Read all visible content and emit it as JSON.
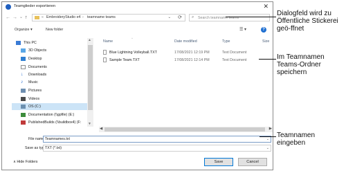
{
  "window": {
    "title": "Teamglieder exportieren",
    "close_glyph": "✕"
  },
  "address": {
    "back_glyph": "←",
    "forward_glyph": "→",
    "recent_glyph": "⌄",
    "up_glyph": "↑",
    "segments": [
      "EmbroideryStudio e4",
      "teamname teams"
    ],
    "chevron": "›",
    "lead_chevron": "«",
    "dropdown_glyph": "⌄",
    "refresh_glyph": "⟳",
    "search_placeholder": "Search teamname teams"
  },
  "toolbar": {
    "organize": "Organize ▾",
    "new_folder": "New folder",
    "view_glyph": "☰ ▾",
    "help": "?"
  },
  "nav": {
    "items": [
      {
        "label": "This PC",
        "icon": "pc-icon",
        "color": "#3a7bd5"
      },
      {
        "label": "3D Objects",
        "icon": "folder-3d-icon",
        "color": "#5aa7e6"
      },
      {
        "label": "Desktop",
        "icon": "desktop-icon",
        "color": "#2f7fd2"
      },
      {
        "label": "Documents",
        "icon": "documents-icon",
        "color": "#8f8f8f"
      },
      {
        "label": "Downloads",
        "icon": "downloads-icon",
        "color": "#2a6fd0"
      },
      {
        "label": "Music",
        "icon": "music-icon",
        "color": "#2a6fd0"
      },
      {
        "label": "Pictures",
        "icon": "pictures-icon",
        "color": "#6f8fb0"
      },
      {
        "label": "Videos",
        "icon": "videos-icon",
        "color": "#4a4a4a"
      },
      {
        "label": "OS (C:)",
        "icon": "drive-icon",
        "color": "#6b8fb0"
      },
      {
        "label": "Documentation (\\\\gpfile) (E:)",
        "icon": "network-drive-icon",
        "color": "#3c8c3c"
      },
      {
        "label": "PublishedBuilds (\\\\buildbox4) (F:",
        "icon": "network-drive-icon",
        "color": "#c03a3a"
      }
    ]
  },
  "files": {
    "columns": [
      "Name",
      "Date modified",
      "Type",
      "Size"
    ],
    "sort_caret": "^",
    "rows": [
      {
        "name": "Blue Lightning Volleyball.TXT",
        "date": "17/08/2021 12:19 PM",
        "type": "Text Document"
      },
      {
        "name": "Sample Team.TXT",
        "date": "17/08/2021 12:14 PM",
        "type": "Text Document"
      }
    ]
  },
  "form": {
    "filename_label": "File name:",
    "filename_value": "Teamnames.txt",
    "type_label": "Save as type:",
    "type_value": "TXT (*.txt)",
    "combo_glyph": "⌄"
  },
  "footer": {
    "hide_folders": "∧  Hide Folders",
    "save": "Save",
    "cancel": "Cancel"
  },
  "callouts": {
    "dialog_opened": [
      "Dialogfeld wird zu",
      "Öffentliche Stickerei",
      "geö-ffnet"
    ],
    "teams_folder": [
      "Im Teamnamen",
      "Teams-Ordner",
      "speichern"
    ],
    "enter_name": [
      "Teamnamen",
      "eingeben"
    ]
  }
}
